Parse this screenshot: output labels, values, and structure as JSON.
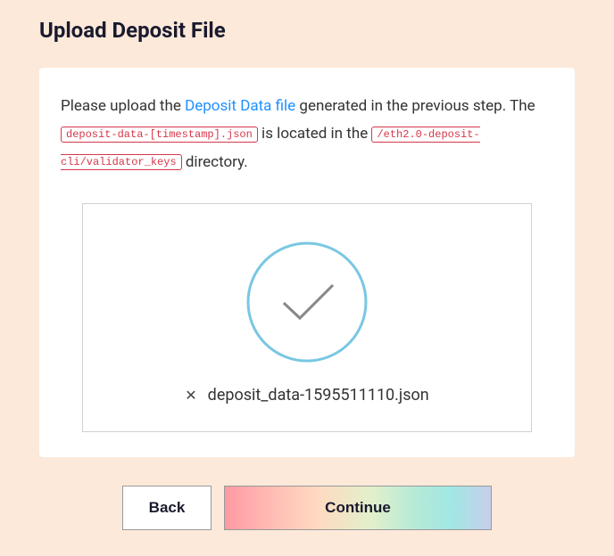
{
  "page": {
    "title": "Upload Deposit File"
  },
  "instructions": {
    "prefix": "Please upload the ",
    "link_text": "Deposit Data file",
    "after_link": " generated in the previous step. The ",
    "filename_badge": "deposit-data-[timestamp].json",
    "between_badges": " is located in the ",
    "path_badge": "/eth2.0-deposit-cli/validator_keys",
    "suffix": " directory."
  },
  "upload": {
    "filename": "deposit_data-1595511110.json",
    "status": "success"
  },
  "actions": {
    "back_label": "Back",
    "continue_label": "Continue"
  },
  "colors": {
    "accent_blue": "#1e90ff",
    "danger": "#d63649",
    "check_stroke": "#79c7e3"
  }
}
